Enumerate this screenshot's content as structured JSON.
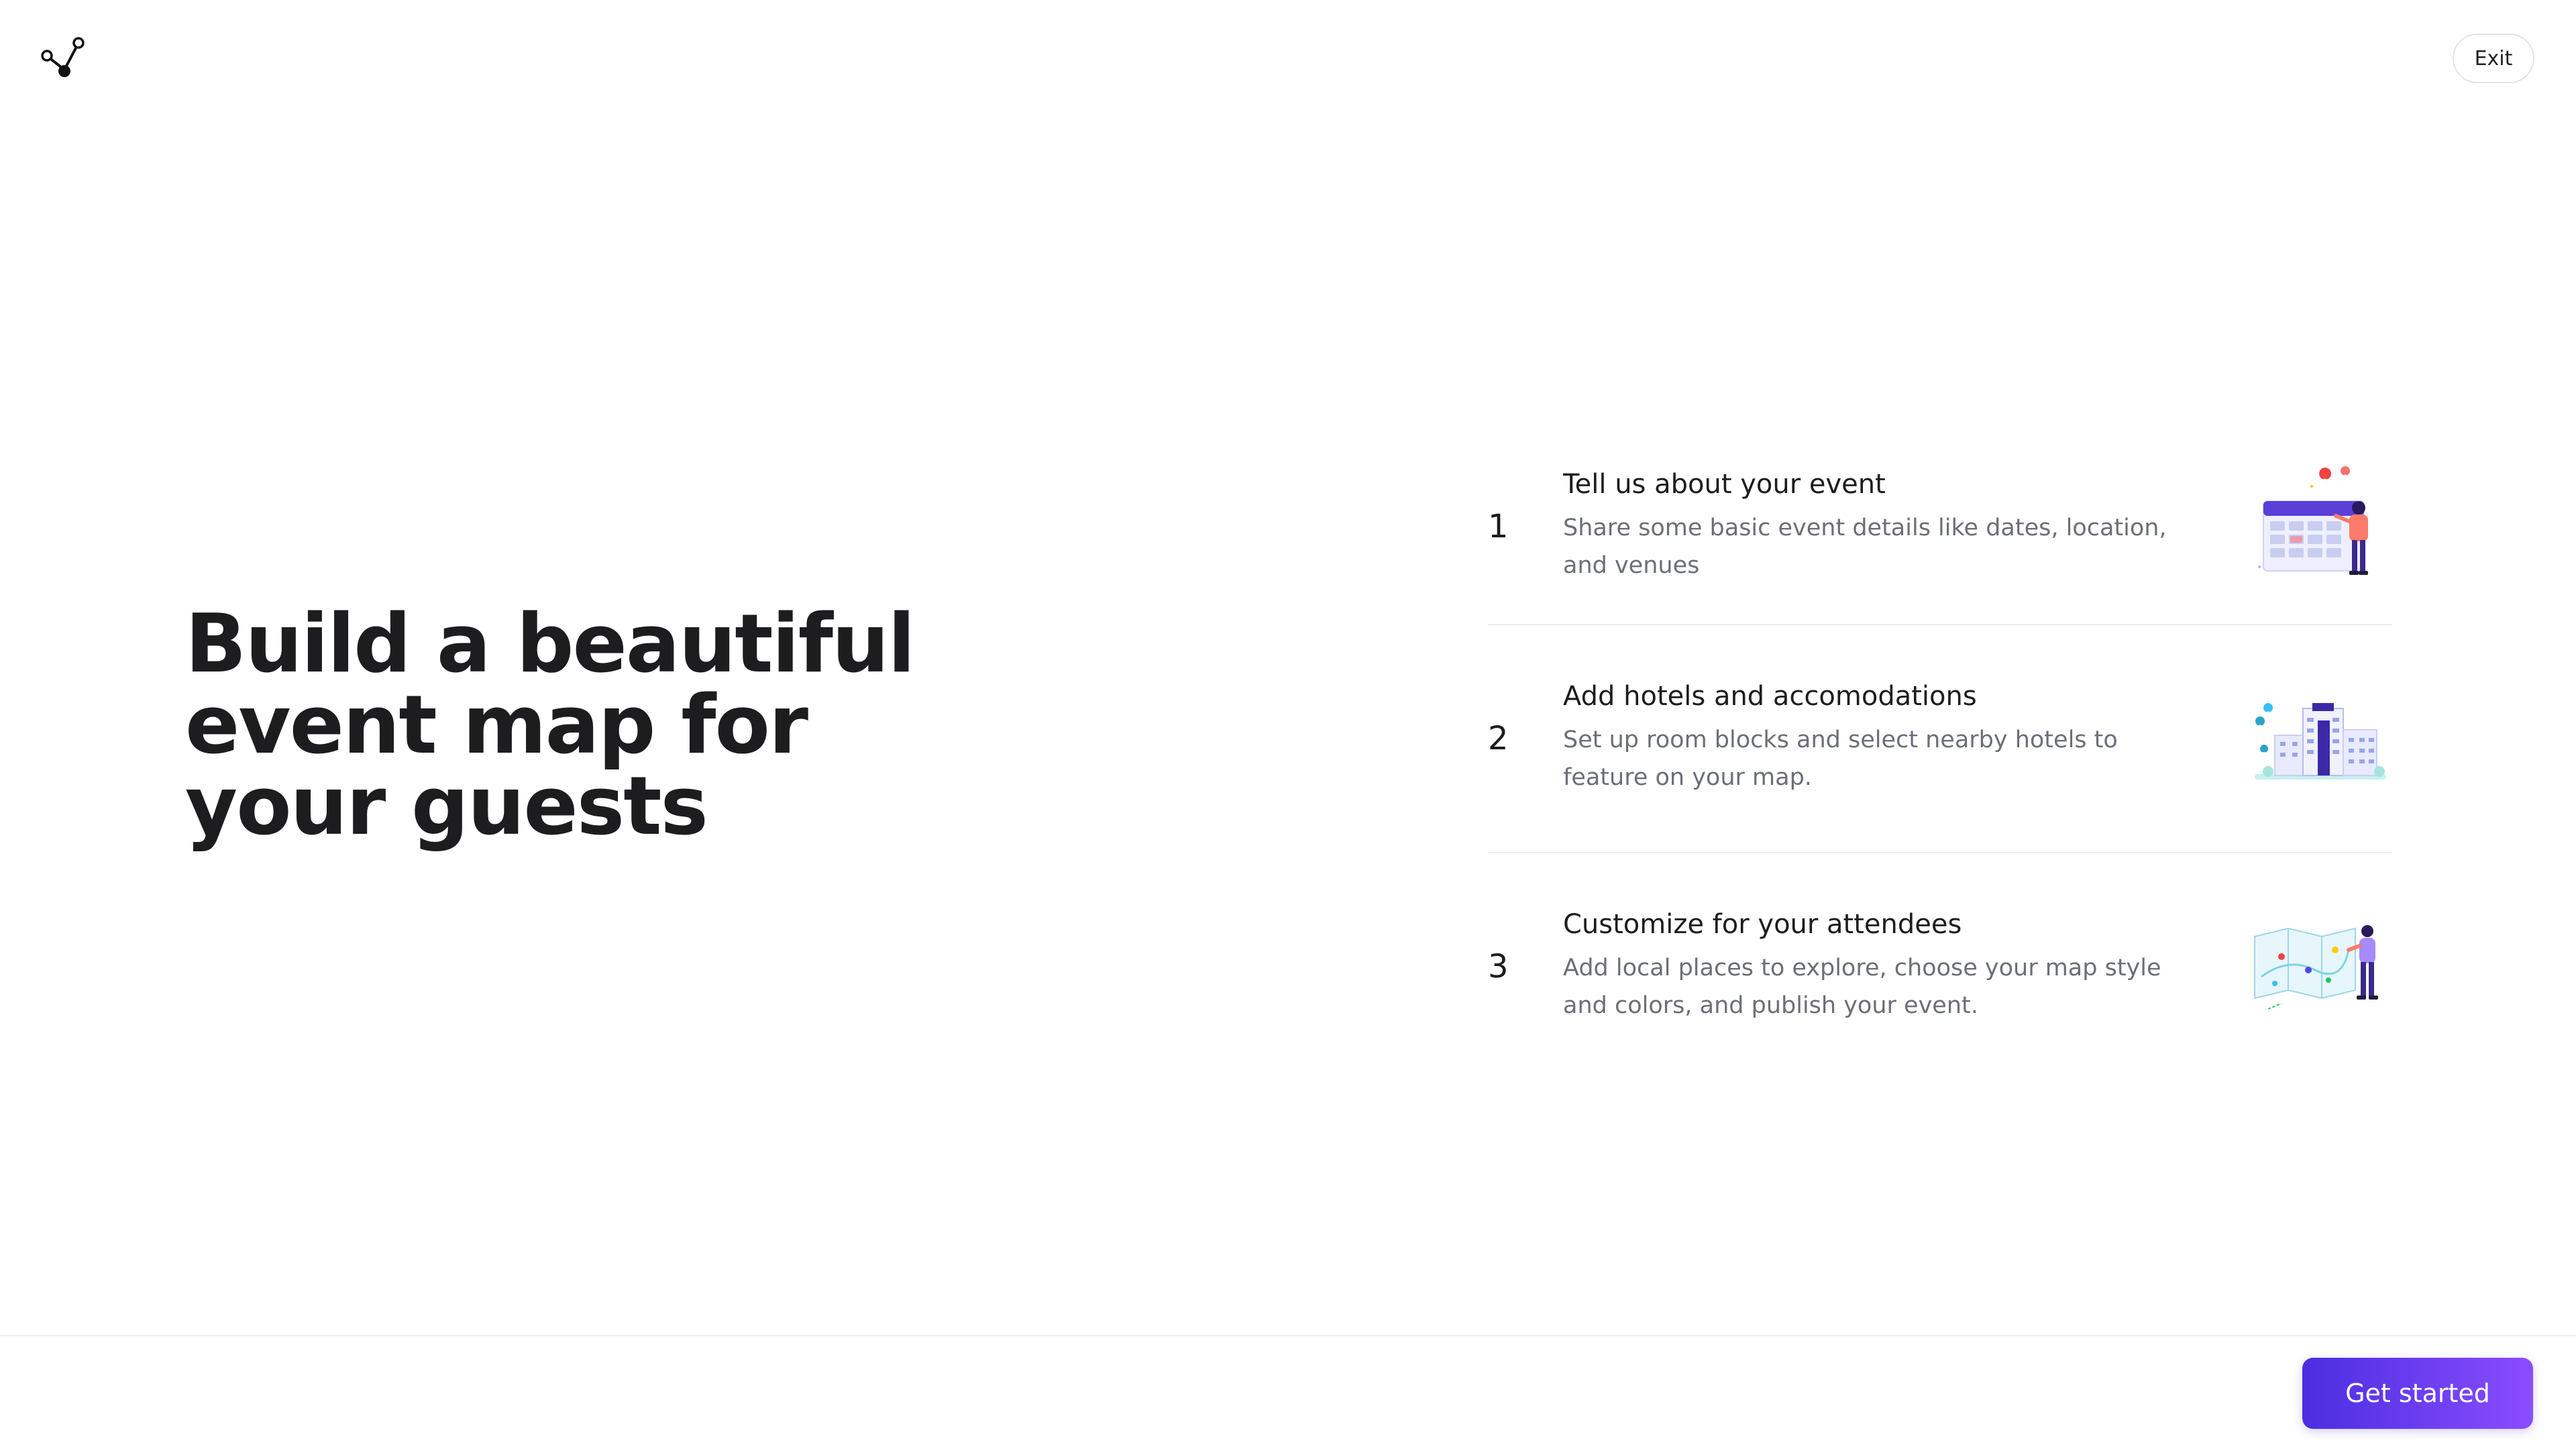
{
  "header": {
    "logo_icon": "graph-node-icon",
    "exit_label": "Exit"
  },
  "hero": {
    "line1": "Build a beautiful",
    "line2": "event map for",
    "line3": "your guests"
  },
  "steps": [
    {
      "number": "1",
      "title": "Tell us about your event",
      "description": "Share some basic event details like dates, location, and venues",
      "illustration": "calendar-illustration"
    },
    {
      "number": "2",
      "title": "Add hotels and accomodations",
      "description": "Set up room blocks and select nearby hotels to feature on your map.",
      "illustration": "hotel-illustration"
    },
    {
      "number": "3",
      "title": "Customize for your attendees",
      "description": "Add local places to explore, choose your map style and colors, and publish your event.",
      "illustration": "map-illustration"
    }
  ],
  "footer": {
    "cta_label": "Get started"
  },
  "colors": {
    "accent_start": "#4b2ee0",
    "accent_end": "#8a4dff",
    "text_primary": "#1d1d1f",
    "text_secondary": "#6b6f76"
  }
}
